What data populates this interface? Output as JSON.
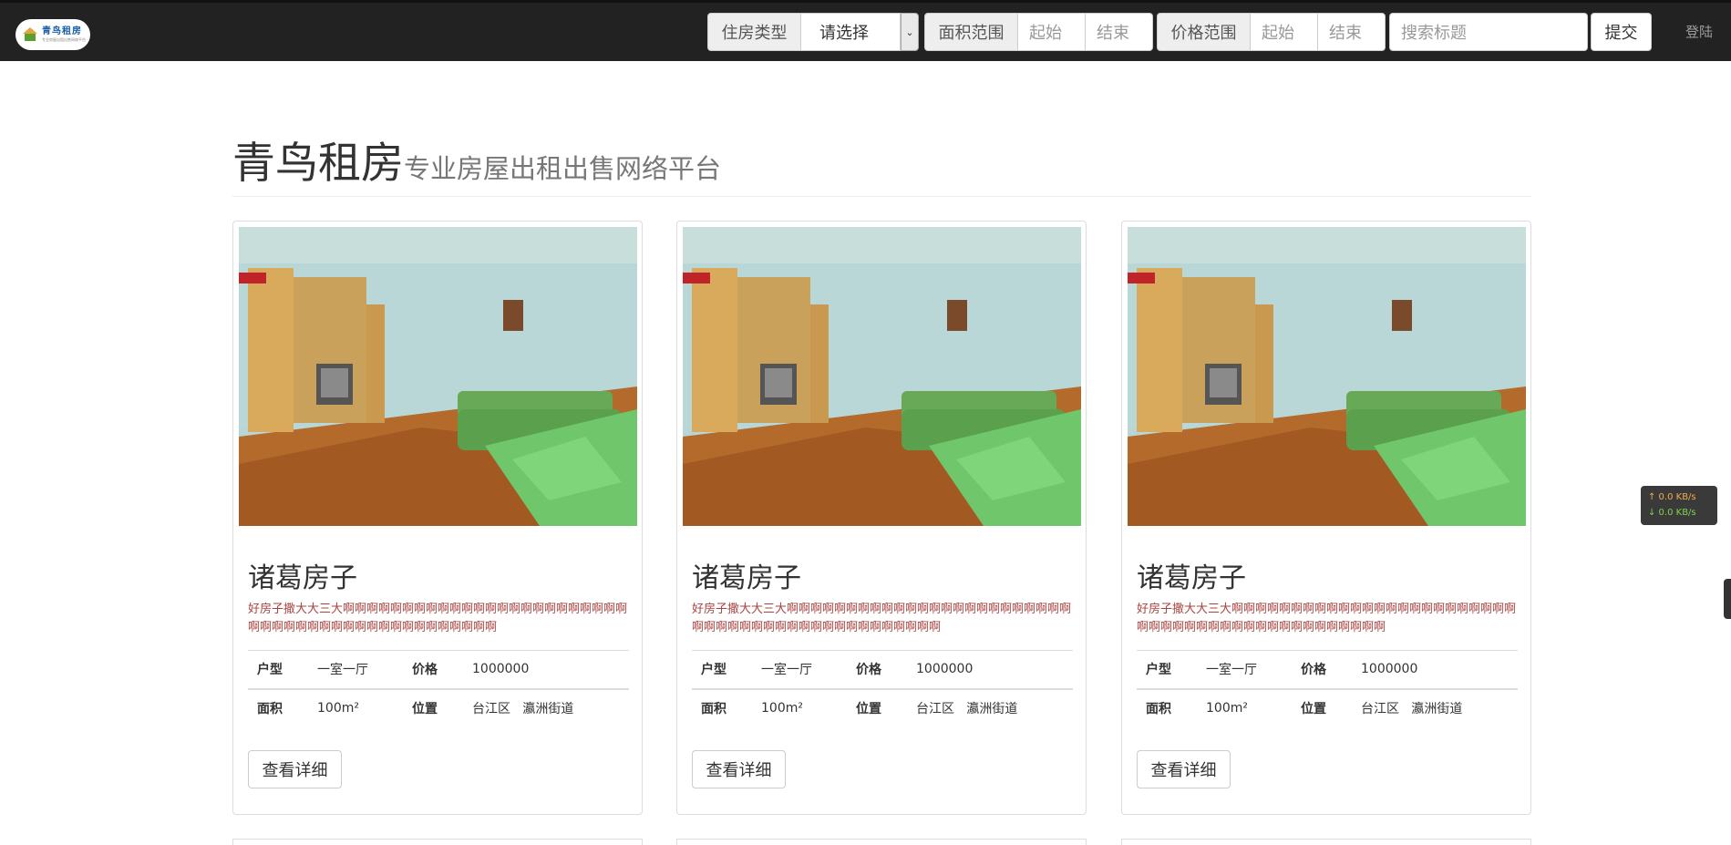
{
  "brand": {
    "logo_text": "青鸟租房",
    "logo_sub": "专业房屋出租出售网络平台"
  },
  "search": {
    "house_type_label": "住房类型",
    "house_type_selected": "请选择",
    "area_label": "面积范围",
    "area_start_placeholder": "起始",
    "area_end_placeholder": "结束",
    "price_label": "价格范围",
    "price_start_placeholder": "起始",
    "price_end_placeholder": "结束",
    "title_placeholder": "搜索标题",
    "submit_label": "提交"
  },
  "nav": {
    "login_label": "登陆"
  },
  "header": {
    "title": "青鸟租房",
    "subtitle": "专业房屋出租出售网络平台"
  },
  "listings": [
    {
      "title": "诸葛房子",
      "desc": "好房子撒大大三大啊啊啊啊啊啊啊啊啊啊啊啊啊啊啊啊啊啊啊啊啊啊啊啊啊啊啊啊啊啊啊啊啊啊啊啊啊啊啊啊啊啊啊啊啊",
      "layout_label": "户型",
      "layout": "一室一厅",
      "price_label": "价格",
      "price": "1000000",
      "area_label": "面积",
      "area": "100m²",
      "location_label": "位置",
      "district": "台江区",
      "street": "瀛洲街道",
      "detail_label": "查看详细"
    },
    {
      "title": "诸葛房子",
      "desc": "好房子撒大大三大啊啊啊啊啊啊啊啊啊啊啊啊啊啊啊啊啊啊啊啊啊啊啊啊啊啊啊啊啊啊啊啊啊啊啊啊啊啊啊啊啊啊啊啊啊",
      "layout_label": "户型",
      "layout": "一室一厅",
      "price_label": "价格",
      "price": "1000000",
      "area_label": "面积",
      "area": "100m²",
      "location_label": "位置",
      "district": "台江区",
      "street": "瀛洲街道",
      "detail_label": "查看详细"
    },
    {
      "title": "诸葛房子",
      "desc": "好房子撒大大三大啊啊啊啊啊啊啊啊啊啊啊啊啊啊啊啊啊啊啊啊啊啊啊啊啊啊啊啊啊啊啊啊啊啊啊啊啊啊啊啊啊啊啊啊啊",
      "layout_label": "户型",
      "layout": "一室一厅",
      "price_label": "价格",
      "price": "1000000",
      "area_label": "面积",
      "area": "100m²",
      "location_label": "位置",
      "district": "台江区",
      "street": "瀛洲街道",
      "detail_label": "查看详细"
    }
  ],
  "speed_widget": {
    "up": "↑ 0.0 KB/s",
    "down": "↓ 0.0 KB/s"
  },
  "colors": {
    "topbar": "#222222",
    "desc_text": "#a94442",
    "panel_border": "#dddddd"
  }
}
